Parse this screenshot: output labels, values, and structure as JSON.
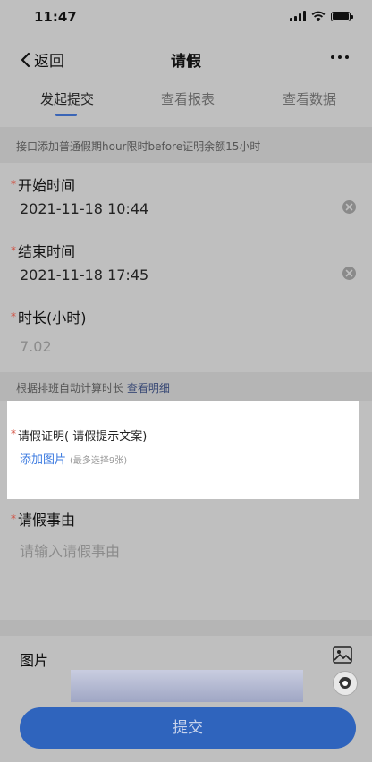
{
  "status_bar": {
    "time": "11:47"
  },
  "nav": {
    "back_label": "返回",
    "title": "请假"
  },
  "tabs": [
    {
      "label": "发起提交",
      "active": true
    },
    {
      "label": "查看报表",
      "active": false
    },
    {
      "label": "查看数据",
      "active": false
    }
  ],
  "hint": "接口添加普通假期hour限时before证明余额15小时",
  "fields": {
    "start": {
      "label": "开始时间",
      "value": "2021-11-18 10:44"
    },
    "end": {
      "label": "结束时间",
      "value": "2021-11-18 17:45"
    },
    "duration": {
      "label": "时长(小时)",
      "value": "7.02"
    }
  },
  "auto_calc": {
    "text": "根据排班自动计算时长",
    "link": "查看明细"
  },
  "proof": {
    "label": "请假证明( 请假提示文案)",
    "add_label": "添加图片",
    "add_note": "(最多选择9张)"
  },
  "reason": {
    "label": "请假事由",
    "placeholder": "请输入请假事由"
  },
  "photo": {
    "label": "图片"
  },
  "submit_label": "提交",
  "colors": {
    "accent": "#2f64bd",
    "required": "#d24a3a",
    "link": "#3d7be0"
  }
}
